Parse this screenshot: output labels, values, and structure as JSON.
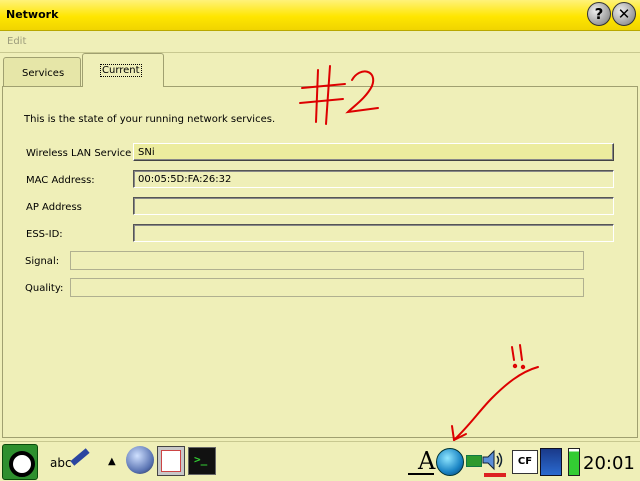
{
  "window": {
    "title": "Network"
  },
  "menu": {
    "edit": "Edit"
  },
  "tabs": [
    {
      "label": "Services"
    },
    {
      "label": "Current"
    }
  ],
  "current": {
    "intro": "This is the state of your running network services.",
    "fields": {
      "wireless_label": "Wireless LAN Service",
      "wireless_value": "SNi",
      "mac_label": "MAC Address:",
      "mac_value": "00:05:5D:FA:26:32",
      "ap_label": "AP Address",
      "ap_value": "",
      "essid_label": "ESS-ID:",
      "essid_value": "",
      "signal_label": "Signal:",
      "signal_value": "",
      "quality_label": "Quality:",
      "quality_value": ""
    }
  },
  "annotation": {
    "text": "#2",
    "exclaim": "!!",
    "color": "#dd0000"
  },
  "taskbar": {
    "input_method": "abc",
    "font_letter": "A",
    "cf_label": "CF",
    "clock": "20:01",
    "icons": [
      "qtopia-logo-icon",
      "handwriting-pencil-icon",
      "up-arrow-icon",
      "network-ball-icon",
      "notepad-icon",
      "terminal-icon",
      "font-a-icon",
      "globe-network-icon",
      "plug-icon",
      "speaker-icon",
      "cf-card-icon",
      "sd-card-icon",
      "battery-icon"
    ]
  },
  "colors": {
    "titlebar": "#ffe600",
    "background": "#efefb8",
    "annotation": "#dd0000"
  }
}
